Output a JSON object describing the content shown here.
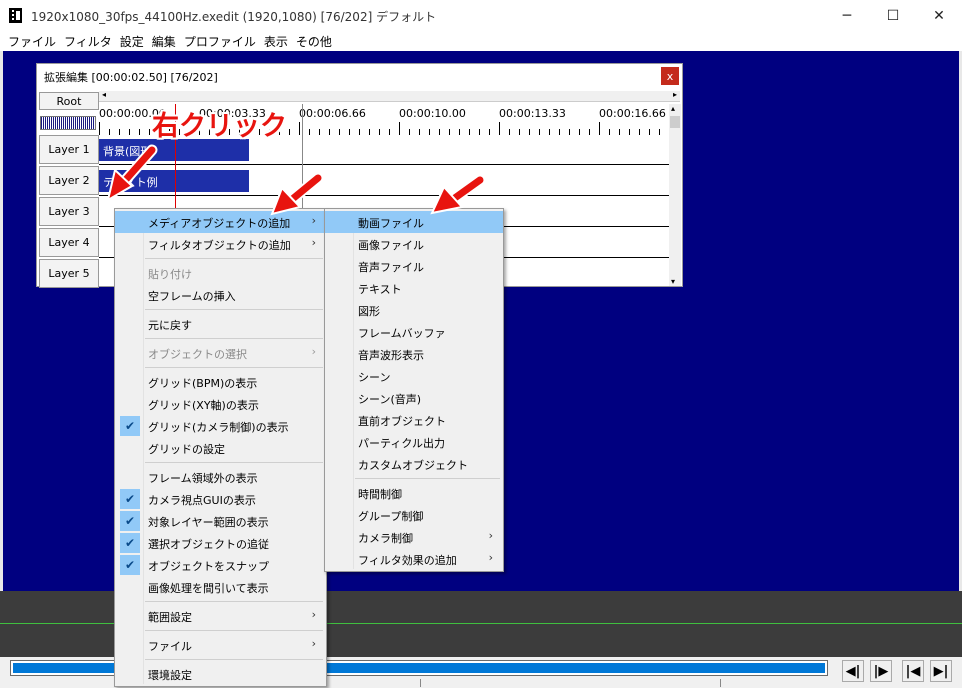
{
  "window": {
    "title": "1920x1080_30fps_44100Hz.exedit (1920,1080)  [76/202]  デフォルト",
    "minimize": "─",
    "maximize": "☐",
    "close": "✕"
  },
  "menubar": [
    "ファイル",
    "フィルタ",
    "設定",
    "編集",
    "プロファイル",
    "表示",
    "その他"
  ],
  "ext_edit": {
    "title": "拡張編集 [00:00:02.50] [76/202]",
    "close": "x",
    "root": "Root",
    "ruler_labels": [
      "00:00:00.00",
      "00:00:03.33",
      "00:00:06.66",
      "00:00:10.00",
      "00:00:13.33",
      "00:00:16.66"
    ],
    "layers": [
      "Layer 1",
      "Layer 2",
      "Layer 3",
      "Layer 4",
      "Layer 5"
    ],
    "clips": [
      {
        "text": "背景(図形)",
        "layer": 1
      },
      {
        "text": "テキスト例",
        "layer": 2
      }
    ]
  },
  "annotation": {
    "text": "右クリック",
    "color": "#e8140f"
  },
  "context_menu": {
    "items": [
      {
        "label": "メディアオブジェクトの追加",
        "submenu": true,
        "highlighted": true
      },
      {
        "label": "フィルタオブジェクトの追加",
        "submenu": true
      },
      {
        "separator": true
      },
      {
        "label": "貼り付け",
        "disabled": true
      },
      {
        "label": "空フレームの挿入"
      },
      {
        "separator": true
      },
      {
        "label": "元に戻す"
      },
      {
        "separator": true
      },
      {
        "label": "オブジェクトの選択",
        "submenu": true,
        "disabled": true
      },
      {
        "separator": true
      },
      {
        "label": "グリッド(BPM)の表示"
      },
      {
        "label": "グリッド(XY軸)の表示"
      },
      {
        "label": "グリッド(カメラ制御)の表示",
        "checked": true
      },
      {
        "label": "グリッドの設定"
      },
      {
        "separator": true
      },
      {
        "label": "フレーム領域外の表示"
      },
      {
        "label": "カメラ視点GUIの表示",
        "checked": true
      },
      {
        "label": "対象レイヤー範囲の表示",
        "checked": true
      },
      {
        "label": "選択オブジェクトの追従",
        "checked": true
      },
      {
        "label": "オブジェクトをスナップ",
        "checked": true
      },
      {
        "label": "画像処理を間引いて表示"
      },
      {
        "separator": true
      },
      {
        "label": "範囲設定",
        "submenu": true
      },
      {
        "separator": true
      },
      {
        "label": "ファイル",
        "submenu": true
      },
      {
        "separator": true
      },
      {
        "label": "環境設定"
      }
    ]
  },
  "media_submenu": {
    "items": [
      {
        "label": "動画ファイル",
        "highlighted": true
      },
      {
        "label": "画像ファイル"
      },
      {
        "label": "音声ファイル"
      },
      {
        "label": "テキスト"
      },
      {
        "label": "図形"
      },
      {
        "label": "フレームバッファ"
      },
      {
        "label": "音声波形表示"
      },
      {
        "label": "シーン"
      },
      {
        "label": "シーン(音声)"
      },
      {
        "label": "直前オブジェクト"
      },
      {
        "label": "パーティクル出力"
      },
      {
        "label": "カスタムオブジェクト"
      },
      {
        "separator": true
      },
      {
        "label": "時間制御"
      },
      {
        "label": "グループ制御"
      },
      {
        "label": "カメラ制御",
        "submenu": true
      },
      {
        "label": "フィルタ効果の追加",
        "submenu": true
      }
    ]
  },
  "glyphs": {
    "submenu_arrow": "›",
    "check": "✔",
    "left_arrow": "◂",
    "right_arrow": "▸",
    "up_arrow": "▴",
    "down_arrow": "▾"
  },
  "nav_buttons": [
    "◀|",
    "|▶",
    "|◀",
    "▶|"
  ]
}
